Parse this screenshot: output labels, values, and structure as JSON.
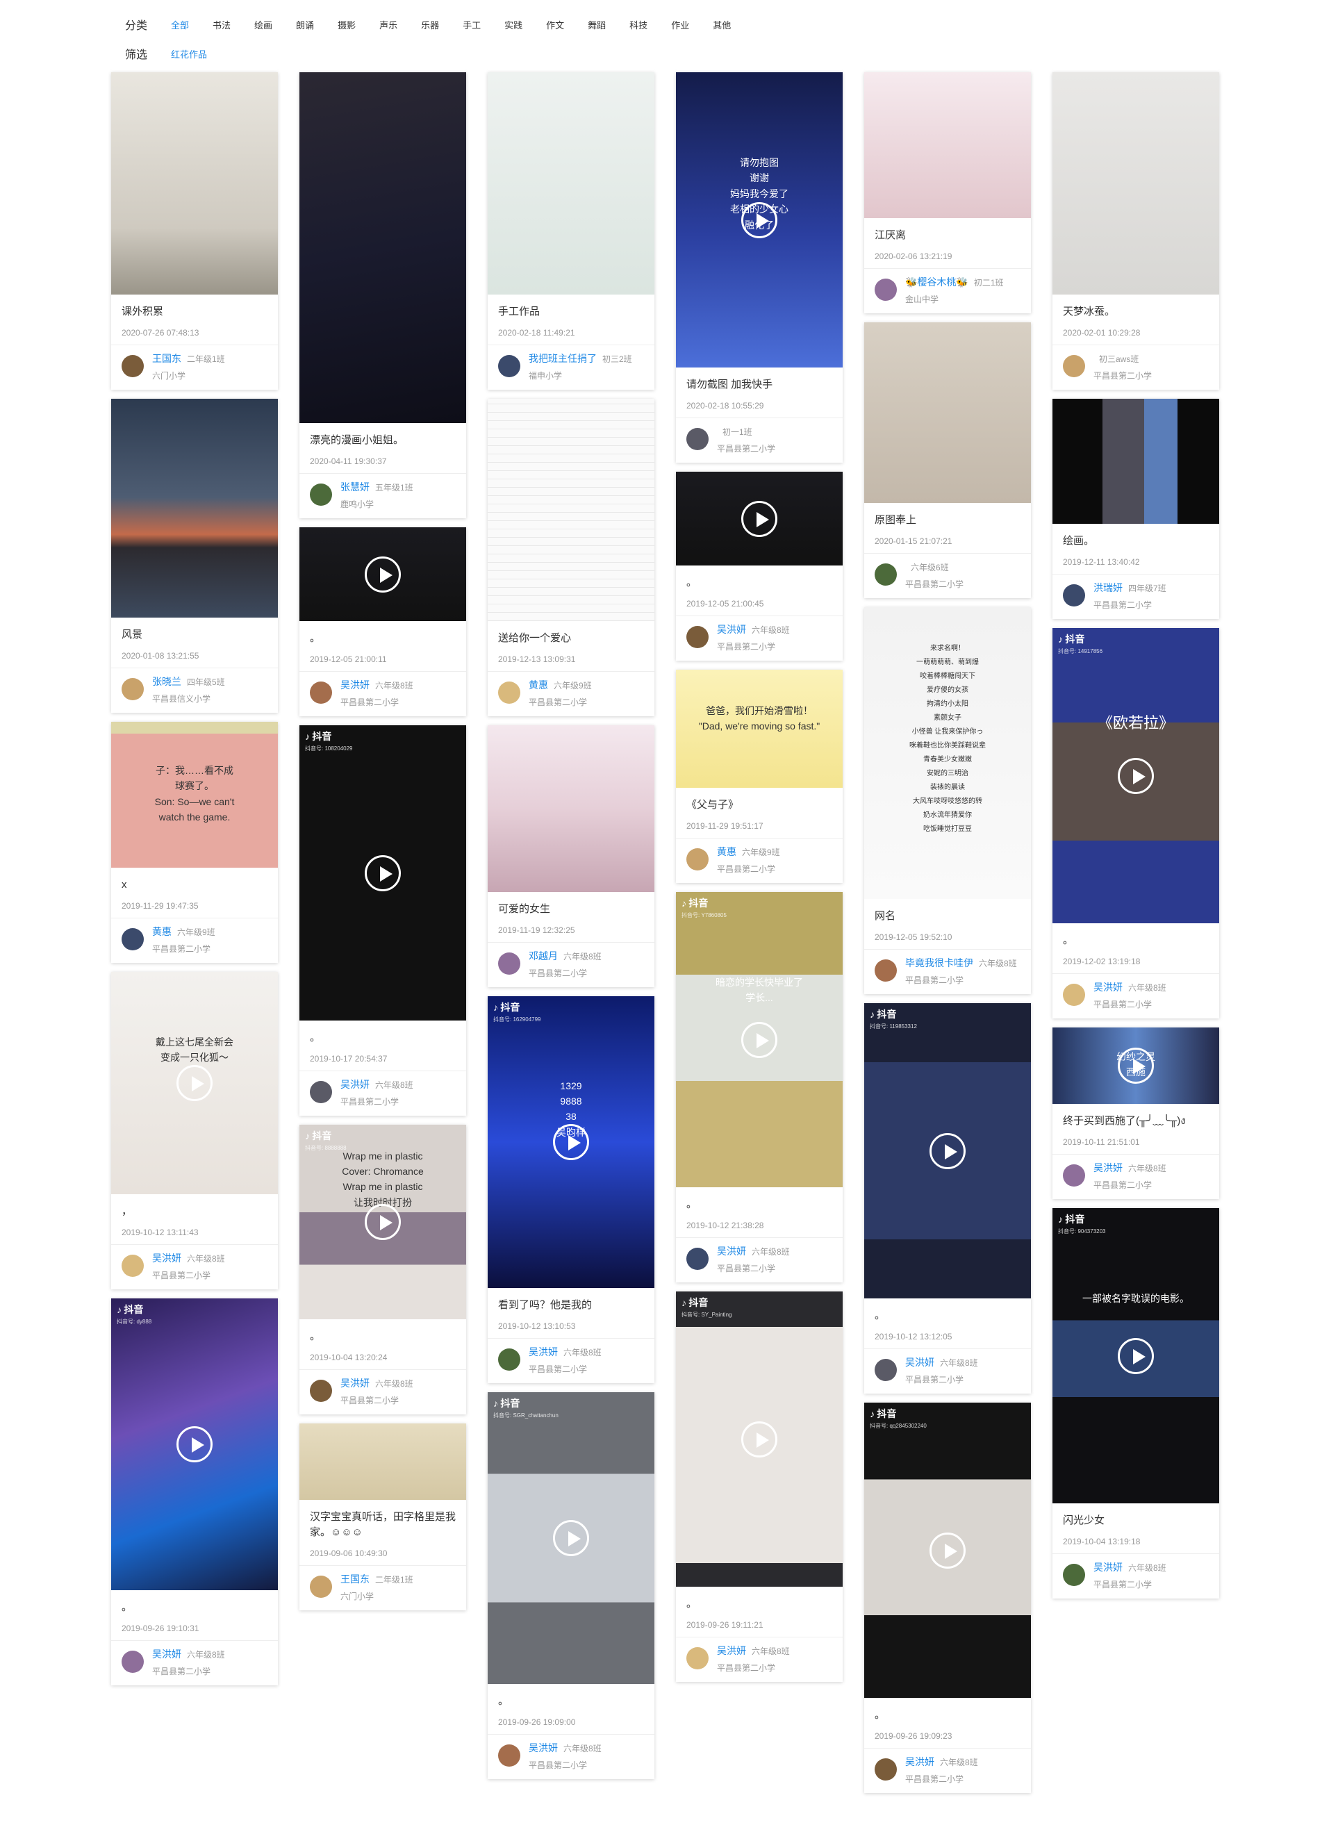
{
  "filters": {
    "category_label": "分类",
    "categories": [
      "全部",
      "书法",
      "绘画",
      "朗诵",
      "摄影",
      "声乐",
      "乐器",
      "手工",
      "实践",
      "作文",
      "舞蹈",
      "科技",
      "作业",
      "其他"
    ],
    "active_category": "全部",
    "screen_label": "筛选",
    "screen_items": [
      "红花作品"
    ],
    "accent_color": "#1e88e5"
  },
  "columns": [
    {
      "cards": [
        {
          "title": "课外积累",
          "date": "2020-07-26 07:48:13",
          "user": "王国东",
          "grade": "二年级1班",
          "school": "六门小学",
          "thumb": "notebook-photo",
          "video": false
        },
        {
          "title": "风景",
          "date": "2020-01-08 13:21:55",
          "user": "张晓兰",
          "grade": "四年级5班",
          "school": "平昌县信义小学",
          "thumb": "sunset-sea-photo",
          "video": false
        },
        {
          "title": "x",
          "date": "2019-11-29 19:47:35",
          "user": "黄惠",
          "grade": "六年级9班",
          "school": "平昌县第二小学",
          "thumb": "father-son-comic",
          "video": false,
          "caption_lines": [
            "子：我……看不成",
            "球赛了。",
            "Son: So—we can't",
            "watch the game."
          ]
        },
        {
          "title": "，",
          "date": "2019-10-12 13:11:43",
          "user": "吴洪妍",
          "grade": "六年级8班",
          "school": "平昌县第二小学",
          "thumb": "nine-tail-fox-drawing",
          "video": true,
          "caption_lines": [
            "戴上这七尾全新会",
            "变成一只化狐～"
          ]
        },
        {
          "title": "。",
          "date": "2019-09-26 19:10:31",
          "user": "吴洪妍",
          "grade": "六年级8班",
          "school": "平昌县第二小学",
          "thumb": "purple-hair-anime-girl",
          "video": true,
          "douyin": "抖音",
          "douyin_id": "抖音号: dy888"
        }
      ]
    },
    {
      "cards": [
        {
          "title": "漂亮的漫画小姐姐。",
          "date": "2020-04-11 19:30:37",
          "user": "张慧妍",
          "grade": "五年级1班",
          "school": "鹿鸣小学",
          "thumb": "elf-anime-girl",
          "video": false
        },
        {
          "title": "。",
          "date": "2019-12-05 21:00:11",
          "user": "吴洪妍",
          "grade": "六年级8班",
          "school": "平昌县第二小学",
          "thumb": "dark-video",
          "video": true
        },
        {
          "title": "。",
          "date": "2019-10-17 20:54:37",
          "user": "吴洪妍",
          "grade": "六年级8班",
          "school": "平昌县第二小学",
          "thumb": "black-video",
          "video": true,
          "douyin": "抖音",
          "douyin_id": "抖音号: 108204029"
        },
        {
          "title": "。",
          "date": "2019-10-04 13:20:24",
          "user": "吴洪妍",
          "grade": "六年级8班",
          "school": "平昌县第二小学",
          "thumb": "wrap-me-in-plastic",
          "video": true,
          "douyin": "抖音",
          "douyin_id": "抖音号: 8888888",
          "caption_lines": [
            "Wrap me in plastic",
            "Cover: Chromance",
            "Wrap me in plastic",
            "让我时时打扮"
          ]
        },
        {
          "title": "汉字宝宝真听话，田字格里是我家。☺☺☺",
          "date": "2019-09-06 10:49:30",
          "user": "王国东",
          "grade": "二年级1班",
          "school": "六门小学",
          "thumb": "calligraphy-paper",
          "video": false
        }
      ]
    },
    {
      "cards": [
        {
          "title": "手工作品",
          "date": "2020-02-18 11:49:21",
          "user": "我把班主任捐了",
          "grade": "初三2班",
          "school": "福申小学",
          "thumb": "crayon-drawing",
          "video": false
        },
        {
          "title": "送给你一个爱心",
          "date": "2019-12-13 13:09:31",
          "user": "黄惠",
          "grade": "六年级9班",
          "school": "平昌县第二小学",
          "thumb": "pixel-bunny-heart",
          "video": false
        },
        {
          "title": "可爱的女生",
          "date": "2019-11-19 12:32:25",
          "user": "邓越月",
          "grade": "六年级8班",
          "school": "平昌县第二小学",
          "thumb": "girl-selfie",
          "video": false
        },
        {
          "title": "看到了吗？他是我的",
          "date": "2019-10-12 13:10:53",
          "user": "吴洪妍",
          "grade": "六年级8班",
          "school": "平昌县第二小学",
          "thumb": "game-hologram",
          "video": true,
          "douyin": "抖音",
          "douyin_id": "抖音号: 162904799",
          "caption_lines": [
            "1329",
            "9888",
            "38",
            "吴昀样"
          ]
        },
        {
          "title": "。",
          "date": "2019-09-26 19:09:00",
          "user": "吴洪妍",
          "grade": "六年级8班",
          "school": "平昌县第二小学",
          "thumb": "pencil-sketch-gray",
          "video": true,
          "douyin": "抖音",
          "douyin_id": "抖音号: SGR_chattanchun"
        }
      ]
    },
    {
      "cards": [
        {
          "title": "请勿截图 加我快手",
          "date": "2020-02-18 10:55:29",
          "user": "",
          "grade": "初一1班",
          "school": "平昌县第二小学",
          "thumb": "night-sky-text",
          "video": true,
          "caption_lines": [
            "请勿抱图",
            "谢谢",
            "妈妈我今爱了",
            "老相的少女心",
            "融化了"
          ]
        },
        {
          "title": "。",
          "date": "2019-12-05 21:00:45",
          "user": "吴洪妍",
          "grade": "六年级8班",
          "school": "平昌县第二小学",
          "thumb": "dark-video",
          "video": true
        },
        {
          "title": "《父与子》",
          "date": "2019-11-29 19:51:17",
          "user": "黄惠",
          "grade": "六年级9班",
          "school": "平昌县第二小学",
          "thumb": "father-son-sled-comic",
          "video": false,
          "caption_lines": [
            "爸爸，我们开始滑雪啦！",
            "\"Dad, we're moving so fast.\""
          ]
        },
        {
          "title": "。",
          "date": "2019-10-12 21:38:28",
          "user": "吴洪妍",
          "grade": "六年级8班",
          "school": "平昌县第二小学",
          "thumb": "graduation-video",
          "video": true,
          "douyin": "抖音",
          "douyin_id": "抖音号: Y7860805",
          "caption_lines": [
            "暗恋的学长快毕业了",
            "学长..."
          ]
        },
        {
          "title": "。",
          "date": "2019-09-26 19:11:21",
          "user": "吴洪妍",
          "grade": "六年级8班",
          "school": "平昌县第二小学",
          "thumb": "brown-sketch",
          "video": true,
          "douyin": "抖音",
          "douyin_id": "抖音号: SY_Painting"
        }
      ]
    },
    {
      "cards": [
        {
          "title": "江厌离",
          "date": "2020-02-06 13:21:19",
          "user": "🐝樱谷木桃🐝",
          "grade": "初二1班",
          "school": "金山中学",
          "thumb": "manga-girl-color",
          "video": false
        },
        {
          "title": "原图奉上",
          "date": "2020-01-15 21:07:21",
          "user": "",
          "grade": "六年级6班",
          "school": "平昌县第二小学",
          "thumb": "pencil-girl-sketch",
          "video": false
        },
        {
          "title": "网名",
          "date": "2019-12-05 19:52:10",
          "user": "毕竟我很卡哇伊",
          "grade": "六年级8班",
          "school": "平昌县第二小学",
          "thumb": "phone-nickname-list",
          "video": false,
          "caption_lines": [
            "来求名啊！",
            "一萌萌萌萌、萌到爆",
            "咬着棒棒糖闯天下",
            "爱疗傻的女孩",
            "拘清约小太阳",
            "素颜女子",
            "小怪兽 让我来保护你っ",
            "咪着鞋也比你美踩鞋说辈",
            "青春美少女嫩嫩",
            "安妮的三明治",
            "装裱的晨读",
            "大风车吱呀吱悠悠的转",
            "奶水流年猜爱你",
            "吃饭睡觉打豆豆"
          ]
        },
        {
          "title": "。",
          "date": "2019-10-12 13:12:05",
          "user": "吴洪妍",
          "grade": "六年级8班",
          "school": "平昌县第二小学",
          "thumb": "dance-game-video",
          "video": true,
          "douyin": "抖音",
          "douyin_id": "抖音号: 119853312"
        },
        {
          "title": "。",
          "date": "2019-09-26 19:09:23",
          "user": "吴洪妍",
          "grade": "六年级8班",
          "school": "平昌县第二小学",
          "thumb": "pencil-anime-sketch",
          "video": true,
          "douyin": "抖音",
          "douyin_id": "抖音号: qq2845302240"
        }
      ]
    },
    {
      "cards": [
        {
          "title": "天梦冰蚕。",
          "date": "2020-02-01 10:29:28",
          "user": "",
          "grade": "初三aws班",
          "school": "平昌县第二小学",
          "thumb": "line-art-girl",
          "video": false
        },
        {
          "title": "绘画。",
          "date": "2019-12-11 13:40:42",
          "user": "洪瑞妍",
          "grade": "四年级7班",
          "school": "平昌县第二小学",
          "thumb": "building-photo",
          "video": false
        },
        {
          "title": "。",
          "date": "2019-12-02 13:19:18",
          "user": "吴洪妍",
          "grade": "六年级8班",
          "school": "平昌县第二小学",
          "thumb": "guitar-video",
          "video": true,
          "douyin": "抖音",
          "douyin_id": "抖音号: 14917856",
          "caption_lines": [
            "《欧若拉》"
          ]
        },
        {
          "title": "终于买到西施了(╥╯﹏╰╥)ง",
          "date": "2019-10-11 21:51:01",
          "user": "吴洪妍",
          "grade": "六年级8班",
          "school": "平昌县第二小学",
          "thumb": "xishi-game",
          "video": true,
          "caption_lines": [
            "幻纱之灵",
            "西施"
          ]
        },
        {
          "title": "闪光少女",
          "date": "2019-10-04 13:19:18",
          "user": "吴洪妍",
          "grade": "六年级8班",
          "school": "平昌县第二小学",
          "thumb": "piano-movie",
          "video": true,
          "douyin": "抖音",
          "douyin_id": "抖音号: 904373203",
          "caption_lines": [
            "一部被名字耽误的电影。"
          ]
        }
      ]
    }
  ]
}
